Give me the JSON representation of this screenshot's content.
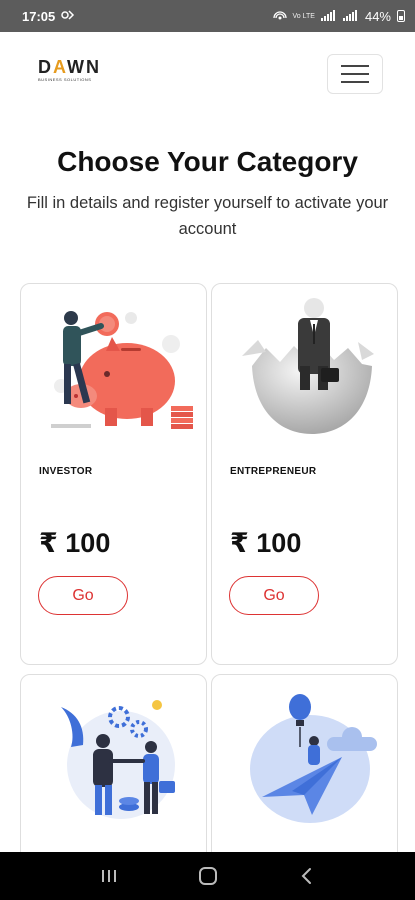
{
  "status_bar": {
    "time": "17:05",
    "network": "Vo LTE",
    "battery": "44%"
  },
  "header": {
    "logo_text_left": "D",
    "logo_text_a": "A",
    "logo_text_right": "WN",
    "logo_subtitle": "BUSINESS SOLUTIONS"
  },
  "main": {
    "title": "Choose Your Category",
    "subtitle": "Fill in details and register yourself to activate your account"
  },
  "cards": [
    {
      "label": "INVESTOR",
      "price": "₹ 100",
      "button": "Go",
      "illustration": "piggy-bank-illustration"
    },
    {
      "label": "ENTREPRENEUR",
      "price": "₹ 100",
      "button": "Go",
      "illustration": "businessman-egg-illustration"
    },
    {
      "label": "",
      "price": "",
      "button": "",
      "illustration": "handshake-illustration"
    },
    {
      "label": "",
      "price": "",
      "button": "",
      "illustration": "paper-plane-illustration"
    }
  ],
  "colors": {
    "accent": "#dd3333",
    "piggy": "#f26b5b",
    "blue": "#3f6fd8"
  }
}
